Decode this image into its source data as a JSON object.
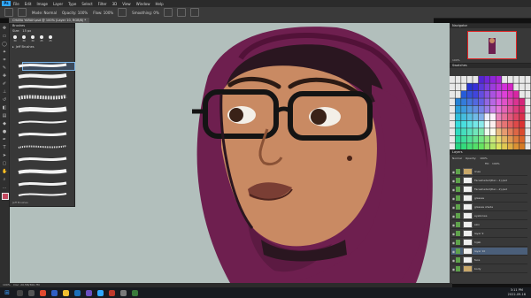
{
  "menubar": {
    "items": [
      "File",
      "Edit",
      "Image",
      "Layer",
      "Type",
      "Select",
      "Filter",
      "3D",
      "View",
      "Window",
      "Help"
    ]
  },
  "options": {
    "mode_label": "Mode:",
    "mode_value": "Normal",
    "opacity_label": "Opacity:",
    "opacity_value": "100%",
    "flow_label": "Flow:",
    "flow_value": "100%",
    "smoothing_label": "Smoothing:",
    "smoothing_value": "0%"
  },
  "document": {
    "tab_title": "CHARA YARAH.psd @ 100% (Layer 10, RGB/8) *"
  },
  "brushes_panel": {
    "title": "Brushes",
    "size_value": "15 px",
    "tip_sizes": [
      "30",
      "30",
      "30",
      "25",
      "25"
    ],
    "group_name": "Jeff Brushes",
    "footer": "Jeff Brushes"
  },
  "navigator": {
    "title": "Navigator",
    "zoom": "100%"
  },
  "swatches": {
    "title": "Swatches"
  },
  "layers": {
    "title": "Layers",
    "blend_mode": "Normal",
    "opacity_value": "100%",
    "fill_value": "100%",
    "items": [
      {
        "name": "lines",
        "type": "folder",
        "selected": false
      },
      {
        "name": "Faceshaded(Dec...1).psd",
        "type": "layer",
        "selected": false
      },
      {
        "name": "Faceshaded(Dec...2).psd",
        "type": "layer",
        "selected": false
      },
      {
        "name": "glasses",
        "type": "layer",
        "selected": false
      },
      {
        "name": "glasses shade",
        "type": "layer",
        "selected": false
      },
      {
        "name": "eyebrows",
        "type": "layer",
        "selected": false
      },
      {
        "name": "skin",
        "type": "layer",
        "selected": false
      },
      {
        "name": "layer 9",
        "type": "layer",
        "selected": false
      },
      {
        "name": "hijab",
        "type": "layer",
        "selected": false
      },
      {
        "name": "layer 10",
        "type": "layer",
        "selected": true
      },
      {
        "name": "face",
        "type": "layer",
        "selected": false
      },
      {
        "name": "body",
        "type": "folder",
        "selected": false
      }
    ]
  },
  "statusbar": {
    "zoom": "100%",
    "doc_size": "Doc: 20.5M/300.7M"
  },
  "taskbar": {
    "time": "3:11 PM",
    "date": "2022-09-16"
  },
  "colors": {
    "canvas_bg": "#b2bfbc",
    "hijab": "#6e1f4f",
    "skin": "#c98a63",
    "accent": "#31a8ff"
  }
}
